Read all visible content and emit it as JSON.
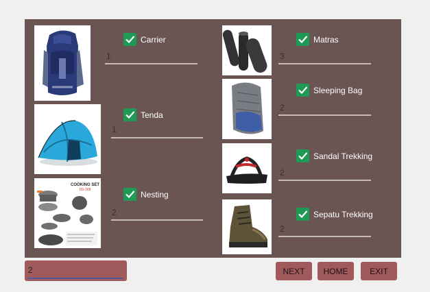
{
  "items": [
    {
      "label": "Carrier",
      "qty": "1"
    },
    {
      "label": "Tenda",
      "qty": "1"
    },
    {
      "label": "Nesting",
      "qty": "2"
    },
    {
      "label": "Matras",
      "qty": "3"
    },
    {
      "label": "Sleeping Bag",
      "qty": "2"
    },
    {
      "label": "Sandal Trekking",
      "qty": "2"
    },
    {
      "label": "Sepatu Trekking",
      "qty": "2"
    }
  ],
  "nesting_image_text": {
    "title": "COOKING SET",
    "subtitle": "DS-308"
  },
  "bottom_input": {
    "value": "2"
  },
  "buttons": {
    "next": "NEXT",
    "home": "HOME",
    "exit": "EXIT"
  },
  "colors": {
    "panel": "#6a5553",
    "button": "#a15a5c",
    "checkbox": "#1f9a55"
  }
}
